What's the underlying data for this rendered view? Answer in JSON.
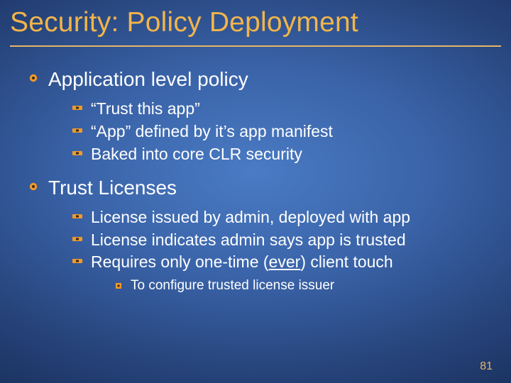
{
  "title": "Security:  Policy Deployment",
  "bullets": {
    "b0": {
      "text": "Application level policy",
      "sub": {
        "s0": "“Trust this app”",
        "s1": "“App” defined by it’s app manifest",
        "s2": "Baked into core CLR security"
      }
    },
    "b1": {
      "text": "Trust Licenses",
      "sub": {
        "s0": "License issued by admin, deployed with app",
        "s1": "License indicates admin says app is trusted",
        "s2_pre": "Requires only one-time (",
        "s2_u": "ever",
        "s2_post": ") client touch",
        "s2_sub": {
          "t0": "To configure trusted license issuer"
        }
      }
    }
  },
  "page_number": "81",
  "colors": {
    "accent": "#f2b54a",
    "bullet_orange": "#f09a2a",
    "bullet_dark": "#3a2a18"
  }
}
